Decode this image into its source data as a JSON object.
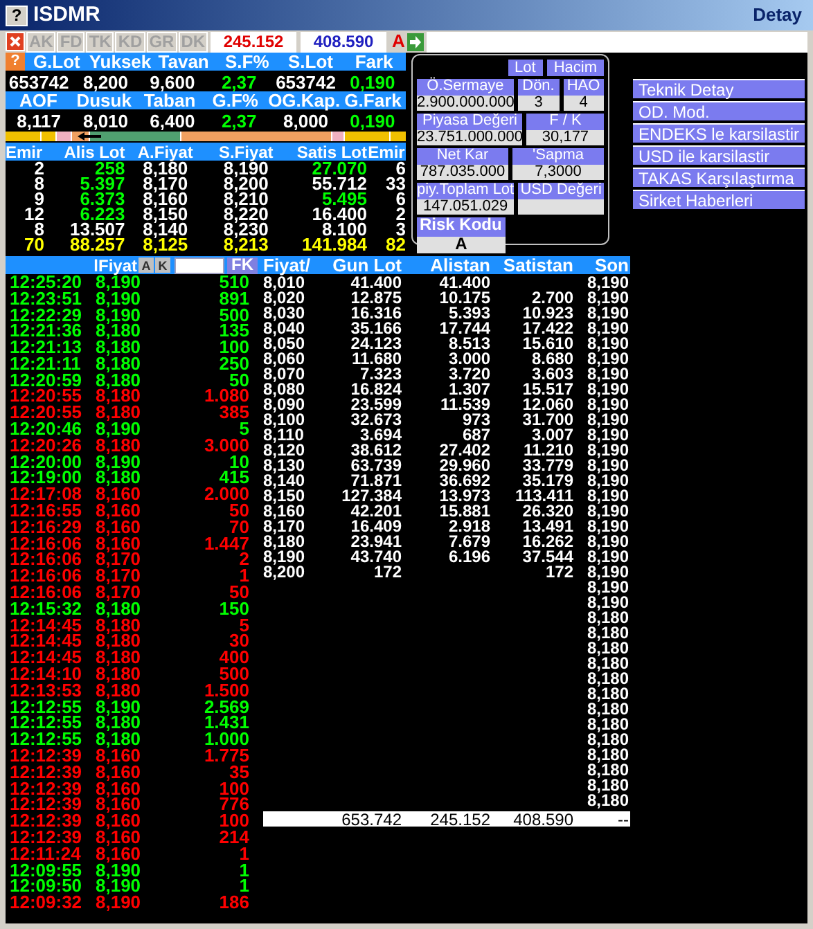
{
  "window": {
    "help": "?",
    "title": "ISDMR",
    "right_title": "Detay"
  },
  "summary_help": "?",
  "toolbar": {
    "tabs": [
      {
        "label": "AK",
        "disabled": true
      },
      {
        "label": "FD",
        "disabled": true
      },
      {
        "label": "TK",
        "disabled": true
      },
      {
        "label": "KD",
        "disabled": true
      },
      {
        "label": "GR",
        "disabled": true
      },
      {
        "label": "DK",
        "disabled": true
      }
    ],
    "bid_total": "245.152",
    "ask_total": "408.590",
    "risk_letter": "A"
  },
  "summary": [
    {
      "labels": [
        "G.Lot",
        "Yuksek",
        "Tavan",
        "S.F%",
        "S.Lot",
        "Fark"
      ],
      "values": [
        {
          "text": "653742",
          "color": "#ffffff"
        },
        {
          "text": "8,200",
          "color": "#ffffff"
        },
        {
          "text": "9,600",
          "color": "#ffffff"
        },
        {
          "text": "2,37",
          "color": "#00ff00"
        },
        {
          "text": "653742",
          "color": "#ffffff"
        },
        {
          "text": "0,190",
          "color": "#00ff00"
        }
      ]
    },
    {
      "labels": [
        "AOF",
        "Dusuk",
        "Taban",
        "G.F%",
        "OG.Kap.",
        "G.Fark"
      ],
      "values": [
        {
          "text": "8,117",
          "color": "#ffffff"
        },
        {
          "text": "8,010",
          "color": "#ffffff"
        },
        {
          "text": "6,400",
          "color": "#ffffff"
        },
        {
          "text": "2,37",
          "color": "#00ff00"
        },
        {
          "text": "8,000",
          "color": "#ffffff"
        },
        {
          "text": "0,190",
          "color": "#00ff00"
        }
      ]
    }
  ],
  "depth": {
    "columns": [
      "Emir",
      "Alis Lot",
      "A.Fiyat",
      "S.Fiyat",
      "Satis Lot",
      "Emir"
    ],
    "rows": [
      {
        "cells": [
          {
            "text": "2",
            "color": "#ffffff"
          },
          {
            "text": "258",
            "color": "#00ff00"
          },
          {
            "text": "8,180",
            "color": "#ffffff"
          },
          {
            "text": "8,190",
            "color": "#ffffff"
          },
          {
            "text": "27.070",
            "color": "#00ff00"
          },
          {
            "text": "6",
            "color": "#ffffff"
          }
        ]
      },
      {
        "cells": [
          {
            "text": "8",
            "color": "#ffffff"
          },
          {
            "text": "5.397",
            "color": "#00ff00"
          },
          {
            "text": "8,170",
            "color": "#ffffff"
          },
          {
            "text": "8,200",
            "color": "#ffffff"
          },
          {
            "text": "55.712",
            "color": "#ffffff"
          },
          {
            "text": "33",
            "color": "#ffffff"
          }
        ]
      },
      {
        "cells": [
          {
            "text": "9",
            "color": "#ffffff"
          },
          {
            "text": "6.373",
            "color": "#00ff00"
          },
          {
            "text": "8,160",
            "color": "#ffffff"
          },
          {
            "text": "8,210",
            "color": "#ffffff"
          },
          {
            "text": "5.495",
            "color": "#00ff00"
          },
          {
            "text": "6",
            "color": "#ffffff"
          }
        ]
      },
      {
        "cells": [
          {
            "text": "12",
            "color": "#ffffff"
          },
          {
            "text": "6.223",
            "color": "#00ff00"
          },
          {
            "text": "8,150",
            "color": "#ffffff"
          },
          {
            "text": "8,220",
            "color": "#ffffff"
          },
          {
            "text": "16.400",
            "color": "#ffffff"
          },
          {
            "text": "2",
            "color": "#ffffff"
          }
        ]
      },
      {
        "cells": [
          {
            "text": "8",
            "color": "#ffffff"
          },
          {
            "text": "13.507",
            "color": "#ffffff"
          },
          {
            "text": "8,140",
            "color": "#ffffff"
          },
          {
            "text": "8,230",
            "color": "#ffffff"
          },
          {
            "text": "8.100",
            "color": "#ffffff"
          },
          {
            "text": "3",
            "color": "#ffffff"
          }
        ]
      },
      {
        "cells": [
          {
            "text": "70",
            "color": "#ffff00"
          },
          {
            "text": "88.257",
            "color": "#ffff00"
          },
          {
            "text": "8,125",
            "color": "#ffff00"
          },
          {
            "text": "8,213",
            "color": "#ffff00"
          },
          {
            "text": "141.984",
            "color": "#ffff00"
          },
          {
            "text": "82",
            "color": "#ffff00"
          }
        ]
      }
    ]
  },
  "info_panel": {
    "buttons": [
      {
        "label": "Lot",
        "selected": false
      },
      {
        "label": "Hacim",
        "selected": false
      }
    ],
    "fields": [
      [
        {
          "label": "Ö.Sermaye",
          "value": "2.900.000.000"
        },
        {
          "label": "Dön.",
          "value": "3"
        },
        {
          "label": "HAO",
          "value": "4"
        }
      ],
      [
        {
          "label": "Piyasa Değeri",
          "value": "23.751.000.000"
        },
        {
          "label": "F / K",
          "value": "30,177"
        }
      ],
      [
        {
          "label": "Net Kar",
          "value": "787.035.000"
        },
        {
          "label": "'Sapma",
          "value": "7,3000"
        }
      ],
      [
        {
          "label": "piy.Toplam Lot",
          "value": "147.051.029"
        },
        {
          "label": "USD Değeri"
        }
      ]
    ],
    "risk": {
      "label": "Risk Kodu",
      "value": "A"
    }
  },
  "menu": [
    "Teknik Detay",
    "OD. Mod.",
    "ENDEKS le karsilastir",
    "USD ile karsilastir",
    "TAKAS Karşılaştırma",
    "Sirket Haberleri"
  ],
  "trades": {
    "header": "lFiyat",
    "buttons": [
      "A",
      "K"
    ],
    "filter_button": "FK",
    "rows": [
      {
        "time": "12:25:20",
        "price": "8,190",
        "lot": "510",
        "color": "#00ff00"
      },
      {
        "time": "12:23:51",
        "price": "8,190",
        "lot": "891",
        "color": "#00ff00"
      },
      {
        "time": "12:22:29",
        "price": "8,190",
        "lot": "500",
        "color": "#00ff00"
      },
      {
        "time": "12:21:36",
        "price": "8,180",
        "lot": "135",
        "color": "#00ff00"
      },
      {
        "time": "12:21:13",
        "price": "8,180",
        "lot": "100",
        "color": "#00ff00"
      },
      {
        "time": "12:21:11",
        "price": "8,180",
        "lot": "250",
        "color": "#00ff00"
      },
      {
        "time": "12:20:59",
        "price": "8,180",
        "lot": "50",
        "color": "#00ff00"
      },
      {
        "time": "12:20:55",
        "price": "8,180",
        "lot": "1.080",
        "color": "#ff0000"
      },
      {
        "time": "12:20:55",
        "price": "8,180",
        "lot": "385",
        "color": "#ff0000"
      },
      {
        "time": "12:20:46",
        "price": "8,190",
        "lot": "5",
        "color": "#00ff00"
      },
      {
        "time": "12:20:26",
        "price": "8,180",
        "lot": "3.000",
        "color": "#ff0000"
      },
      {
        "time": "12:20:00",
        "price": "8,190",
        "lot": "10",
        "color": "#00ff00"
      },
      {
        "time": "12:19:00",
        "price": "8,180",
        "lot": "415",
        "color": "#00ff00"
      },
      {
        "time": "12:17:08",
        "price": "8,160",
        "lot": "2.000",
        "color": "#ff0000"
      },
      {
        "time": "12:16:55",
        "price": "8,160",
        "lot": "50",
        "color": "#ff0000"
      },
      {
        "time": "12:16:29",
        "price": "8,160",
        "lot": "70",
        "color": "#ff0000"
      },
      {
        "time": "12:16:06",
        "price": "8,160",
        "lot": "1.447",
        "color": "#ff0000"
      },
      {
        "time": "12:16:06",
        "price": "8,170",
        "lot": "2",
        "color": "#ff0000"
      },
      {
        "time": "12:16:06",
        "price": "8,170",
        "lot": "1",
        "color": "#ff0000"
      },
      {
        "time": "12:16:06",
        "price": "8,170",
        "lot": "50",
        "color": "#ff0000"
      },
      {
        "time": "12:15:32",
        "price": "8,180",
        "lot": "150",
        "color": "#00ff00"
      },
      {
        "time": "12:14:45",
        "price": "8,180",
        "lot": "5",
        "color": "#ff0000"
      },
      {
        "time": "12:14:45",
        "price": "8,180",
        "lot": "30",
        "color": "#ff0000"
      },
      {
        "time": "12:14:45",
        "price": "8,180",
        "lot": "400",
        "color": "#ff0000"
      },
      {
        "time": "12:14:10",
        "price": "8,180",
        "lot": "500",
        "color": "#ff0000"
      },
      {
        "time": "12:13:53",
        "price": "8,180",
        "lot": "1.500",
        "color": "#ff0000"
      },
      {
        "time": "12:12:55",
        "price": "8,190",
        "lot": "2.569",
        "color": "#00ff00"
      },
      {
        "time": "12:12:55",
        "price": "8,180",
        "lot": "1.431",
        "color": "#00ff00"
      },
      {
        "time": "12:12:55",
        "price": "8,180",
        "lot": "1.000",
        "color": "#00ff00"
      },
      {
        "time": "12:12:39",
        "price": "8,160",
        "lot": "1.775",
        "color": "#ff0000"
      },
      {
        "time": "12:12:39",
        "price": "8,160",
        "lot": "35",
        "color": "#ff0000"
      },
      {
        "time": "12:12:39",
        "price": "8,160",
        "lot": "100",
        "color": "#ff0000"
      },
      {
        "time": "12:12:39",
        "price": "8,160",
        "lot": "776",
        "color": "#ff0000"
      },
      {
        "time": "12:12:39",
        "price": "8,160",
        "lot": "100",
        "color": "#ff0000"
      },
      {
        "time": "12:12:39",
        "price": "8,160",
        "lot": "214",
        "color": "#ff0000"
      },
      {
        "time": "12:11:24",
        "price": "8,160",
        "lot": "1",
        "color": "#ff0000"
      },
      {
        "time": "12:09:55",
        "price": "8,190",
        "lot": "1",
        "color": "#00ff00"
      },
      {
        "time": "12:09:50",
        "price": "8,190",
        "lot": "1",
        "color": "#00ff00"
      },
      {
        "time": "12:09:32",
        "price": "8,190",
        "lot": "186",
        "color": "#ff0000"
      }
    ]
  },
  "price_table": {
    "columns": [
      "Fiyat/",
      "Gun Lot",
      "Alistan",
      "Satistan",
      "Son"
    ],
    "rows": [
      {
        "price": "8,010",
        "gun_lot": "41.400",
        "alistan": "41.400",
        "son": "8,190"
      },
      {
        "price": "8,020",
        "gun_lot": "12.875",
        "alistan": "10.175",
        "satistan": "2.700",
        "son": "8,190"
      },
      {
        "price": "8,030",
        "gun_lot": "16.316",
        "alistan": "5.393",
        "satistan": "10.923",
        "son": "8,190"
      },
      {
        "price": "8,040",
        "gun_lot": "35.166",
        "alistan": "17.744",
        "satistan": "17.422",
        "son": "8,190"
      },
      {
        "price": "8,050",
        "gun_lot": "24.123",
        "alistan": "8.513",
        "satistan": "15.610",
        "son": "8,190"
      },
      {
        "price": "8,060",
        "gun_lot": "11.680",
        "alistan": "3.000",
        "satistan": "8.680",
        "son": "8,190"
      },
      {
        "price": "8,070",
        "gun_lot": "7.323",
        "alistan": "3.720",
        "satistan": "3.603",
        "son": "8,190"
      },
      {
        "price": "8,080",
        "gun_lot": "16.824",
        "alistan": "1.307",
        "satistan": "15.517",
        "son": "8,190"
      },
      {
        "price": "8,090",
        "gun_lot": "23.599",
        "alistan": "11.539",
        "satistan": "12.060",
        "son": "8,190"
      },
      {
        "price": "8,100",
        "gun_lot": "32.673",
        "alistan": "973",
        "satistan": "31.700",
        "son": "8,190"
      },
      {
        "price": "8,110",
        "gun_lot": "3.694",
        "alistan": "687",
        "satistan": "3.007",
        "son": "8,190"
      },
      {
        "price": "8,120",
        "gun_lot": "38.612",
        "alistan": "27.402",
        "satistan": "11.210",
        "son": "8,190"
      },
      {
        "price": "8,130",
        "gun_lot": "63.739",
        "alistan": "29.960",
        "satistan": "33.779",
        "son": "8,190"
      },
      {
        "price": "8,140",
        "gun_lot": "71.871",
        "alistan": "36.692",
        "satistan": "35.179",
        "son": "8,190"
      },
      {
        "price": "8,150",
        "gun_lot": "127.384",
        "alistan": "13.973",
        "satistan": "113.411",
        "son": "8,190"
      },
      {
        "price": "8,160",
        "gun_lot": "42.201",
        "alistan": "15.881",
        "satistan": "26.320",
        "son": "8,190"
      },
      {
        "price": "8,170",
        "gun_lot": "16.409",
        "alistan": "2.918",
        "satistan": "13.491",
        "son": "8,190"
      },
      {
        "price": "8,180",
        "gun_lot": "23.941",
        "alistan": "7.679",
        "satistan": "16.262",
        "son": "8,190"
      },
      {
        "price": "8,190",
        "gun_lot": "43.740",
        "alistan": "6.196",
        "satistan": "37.544",
        "son": "8,190"
      },
      {
        "price": "8,200",
        "gun_lot": "172",
        "satistan": "172",
        "son": "8,190"
      },
      {
        "son": "8,190"
      },
      {
        "son": "8,190"
      },
      {
        "son": "8,180"
      },
      {
        "son": "8,180"
      },
      {
        "son": "8,180"
      },
      {
        "son": "8,180"
      },
      {
        "son": "8,180"
      },
      {
        "son": "8,180"
      },
      {
        "son": "8,180"
      },
      {
        "son": "8,180"
      },
      {
        "son": "8,180"
      },
      {
        "son": "8,180"
      },
      {
        "son": "8,180"
      },
      {
        "son": "8,180"
      },
      {
        "son": "8,180"
      }
    ],
    "totals": {
      "gun_lot": "653.742",
      "alistan": "245.152",
      "satistan": "408.590",
      "son": "--"
    }
  }
}
